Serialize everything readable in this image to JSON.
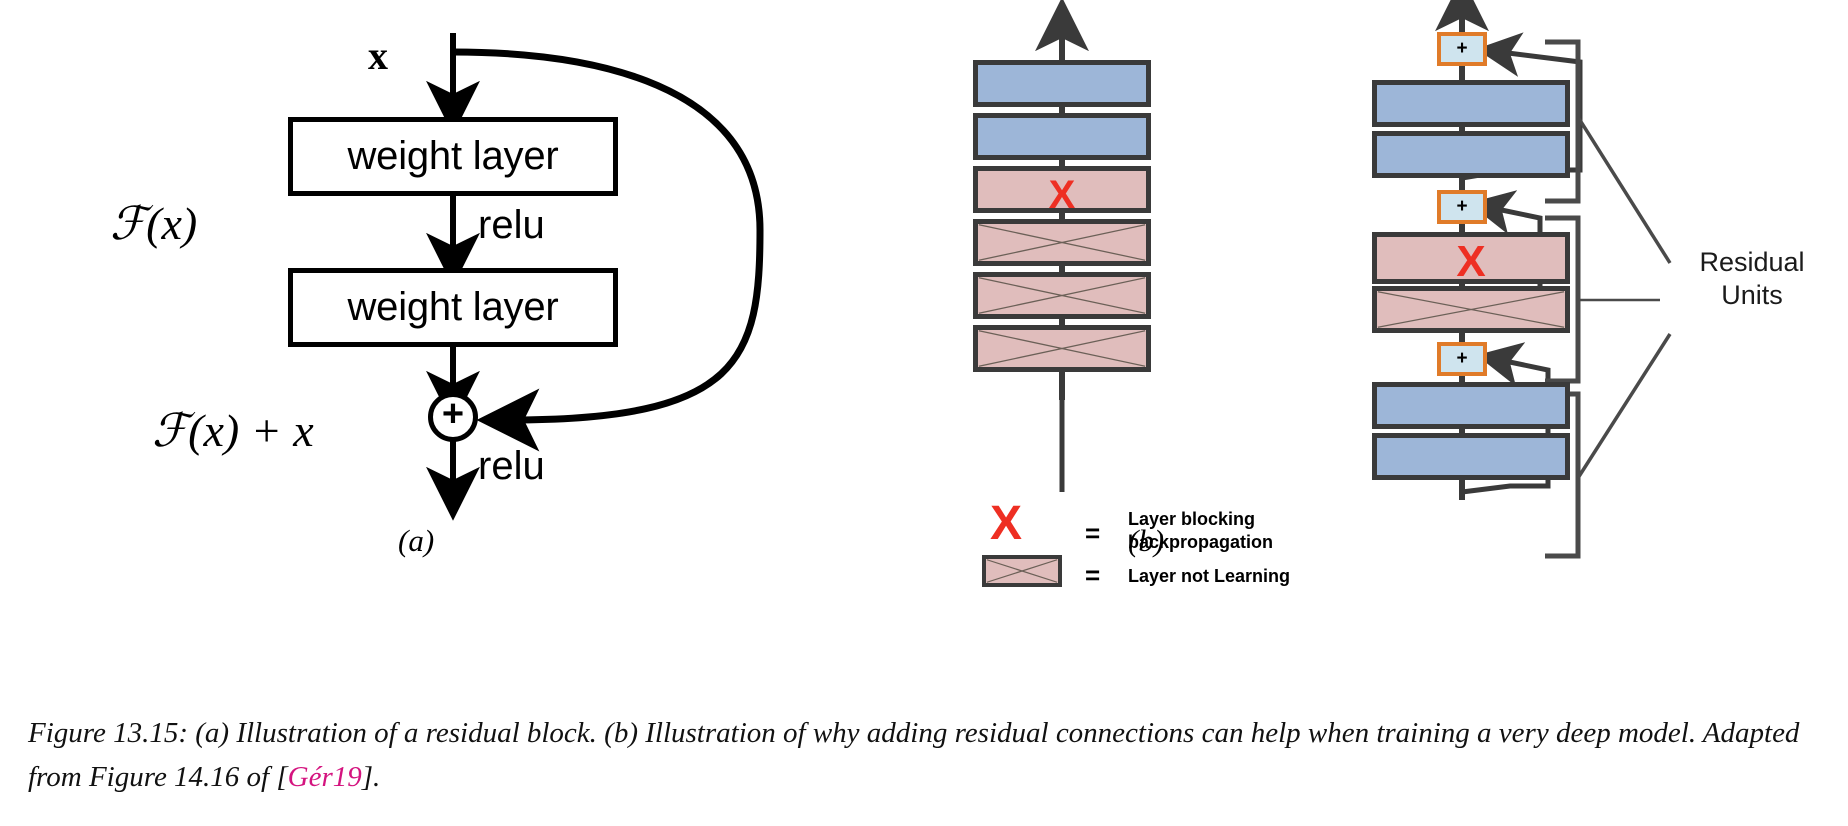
{
  "figure": {
    "caption_prefix": "Figure 13.15: (a) Illustration of a residual block. (b) Illustration of why adding residual connections can help when training a very deep model. Adapted from Figure 14.16 of [",
    "caption_citation": "Gér19",
    "caption_suffix": "].",
    "sublabel_a": "(a)",
    "sublabel_b": "(b)"
  },
  "panel_a": {
    "input_label": "x",
    "fx_label": "ℱ(x)",
    "fx_plus_x_label": "ℱ(x) + x",
    "weight_layer_1": "weight layer",
    "weight_layer_2": "weight layer",
    "relu_1": "relu",
    "relu_2": "relu",
    "sum_symbol": "+"
  },
  "panel_b": {
    "middle_stack": [
      {
        "id": "m1",
        "type": "blue",
        "label": ""
      },
      {
        "id": "m2",
        "type": "blue",
        "label": ""
      },
      {
        "id": "m3",
        "type": "pink-x",
        "label": "X"
      },
      {
        "id": "m4",
        "type": "pink-crossed",
        "label": ""
      },
      {
        "id": "m5",
        "type": "pink-crossed",
        "label": ""
      },
      {
        "id": "m6",
        "type": "pink-crossed",
        "label": ""
      }
    ],
    "right_stack": [
      {
        "id": "r1",
        "type": "plus",
        "label": "+"
      },
      {
        "id": "r2",
        "type": "blue",
        "label": ""
      },
      {
        "id": "r3",
        "type": "blue",
        "label": ""
      },
      {
        "id": "r4",
        "type": "plus",
        "label": "+"
      },
      {
        "id": "r5",
        "type": "pink-x",
        "label": "X"
      },
      {
        "id": "r6",
        "type": "pink-crossed",
        "label": ""
      },
      {
        "id": "r7",
        "type": "plus",
        "label": "+"
      },
      {
        "id": "r8",
        "type": "blue",
        "label": ""
      },
      {
        "id": "r9",
        "type": "blue",
        "label": ""
      }
    ],
    "legend": {
      "x_symbol": "X",
      "equals_1": "=",
      "text_1": "Layer blocking\nbackpropagation",
      "equals_2": "=",
      "text_2": "Layer not Learning"
    },
    "bracket_label": "Residual\nUnits"
  },
  "colors": {
    "blue_layer": "#9db6d8",
    "pink_layer": "#e0bdbc",
    "x_red": "#ee2f23",
    "plus_border": "#e07b29",
    "plus_fill": "#cfe4ee",
    "box_stroke": "#3a3a3a",
    "citation": "#d4147f"
  }
}
